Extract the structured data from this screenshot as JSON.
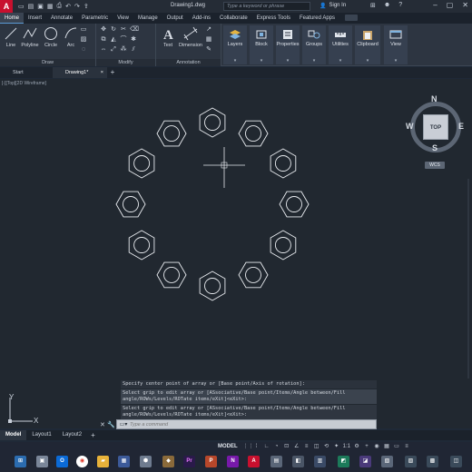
{
  "titlebar": {
    "logo": "A",
    "document_title": "Drawing1.dwg",
    "search_placeholder": "Type a keyword or phrase",
    "signin_label": "Sign In"
  },
  "ribbon_tabs": [
    "Home",
    "Insert",
    "Annotate",
    "Parametric",
    "View",
    "Manage",
    "Output",
    "Add-ins",
    "Collaborate",
    "Express Tools",
    "Featured Apps"
  ],
  "ribbon": {
    "draw_tools": [
      "Line",
      "Polyline",
      "Circle",
      "Arc"
    ],
    "draw_panel_label": "Draw",
    "modify_panel_label": "Modify",
    "annotation_tools": [
      "Text",
      "Dimension"
    ],
    "annotation_panel_label": "Annotation",
    "groups": [
      "Layers",
      "Block",
      "Properties",
      "Groups",
      "Utilities",
      "Clipboard",
      "View"
    ]
  },
  "file_tabs": {
    "start": "Start",
    "drawing": "Drawing1*"
  },
  "viewport_label": "[-][Top][2D Wireframe]",
  "viewcube": {
    "top": "TOP",
    "north": "N",
    "south": "S",
    "east": "E",
    "west": "W",
    "wcs": "WCS"
  },
  "command_history": [
    "Specify center point of array or [Base point/Axis of rotation]:",
    "Select grip to edit array or [ASsociative/Base point/Items/Angle between/Fill angle/ROWs/Levels/ROTate items/eXit]<eXit>:",
    "Select grip to edit array or [ASsociative/Base point/Items/Angle between/Fill angle/ROWs/Levels/ROTate items/eXit]<eXit>:"
  ],
  "command_line": {
    "placeholder": "Type a command"
  },
  "ucs": {
    "x": "X",
    "y": "Y"
  },
  "layout_tabs": [
    "Model",
    "Layout1",
    "Layout2"
  ],
  "statusbar": {
    "model": "MODEL",
    "scale": "1:1"
  },
  "array_items": 12
}
